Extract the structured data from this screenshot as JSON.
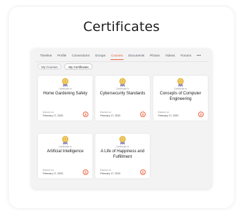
{
  "page": {
    "title": "Certificates"
  },
  "nav": {
    "tabs": [
      "Timeline",
      "Profile",
      "Connections",
      "Groups",
      "Courses",
      "Documents",
      "Photos",
      "Videos",
      "Forums"
    ],
    "active_tab": "Courses",
    "more": "•••"
  },
  "subtabs": {
    "my_courses": "My Courses",
    "my_certificates": "My Certificates",
    "active": "My Certificates"
  },
  "colors": {
    "accent": "#e8603c",
    "badge_gold": "#e2b43c",
    "badge_ribbon": "#8b87c9"
  },
  "certificates": [
    {
      "label": "Certificate in",
      "title": "Home Gardening Safety",
      "earned_label": "Earned on",
      "earned_date": "February 17, 2020"
    },
    {
      "label": "Certificate in",
      "title": "Cybersecurity Standards",
      "earned_label": "Earned on",
      "earned_date": "February 17, 2020"
    },
    {
      "label": "Certificate in",
      "title": "Concepts of Computer Engineering",
      "earned_label": "Earned on",
      "earned_date": "February 17, 2020"
    },
    {
      "label": "Certificate in",
      "title": "Artificial Intelligence",
      "earned_label": "Earned on",
      "earned_date": "February 17, 2020"
    },
    {
      "label": "Certificate in",
      "title": "A Life of Happiness and Fulfillment",
      "earned_label": "Earned on",
      "earned_date": "February 17, 2020"
    }
  ]
}
